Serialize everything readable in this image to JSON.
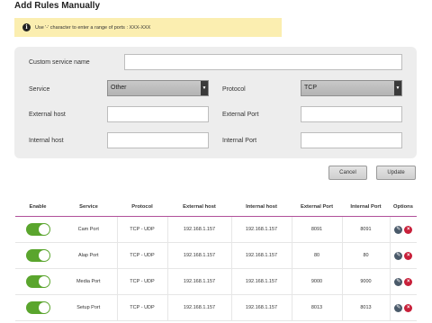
{
  "page": {
    "title": "Add Rules Manually"
  },
  "notice": {
    "text": "Use '-' character to enter a range of ports : XXX-XXX"
  },
  "form": {
    "custom_service_name_label": "Custom service name",
    "custom_service_name_value": "",
    "service_label": "Service",
    "service_value": "Other",
    "protocol_label": "Protocol",
    "protocol_value": "TCP",
    "external_host_label": "External host",
    "external_host_value": "",
    "external_port_label": "External Port",
    "external_port_value": "",
    "internal_host_label": "Internal host",
    "internal_host_value": "",
    "internal_port_label": "Internal Port",
    "internal_port_value": ""
  },
  "actions": {
    "cancel": "Cancel",
    "update": "Update"
  },
  "table": {
    "headers": [
      "Enable",
      "Service",
      "Protocol",
      "External host",
      "Internal host",
      "External Port",
      "Internal Port",
      "Options"
    ],
    "rows": [
      {
        "enabled": true,
        "service": "Cam Port",
        "protocol": "TCP - UDP",
        "external_host": "192.168.1.157",
        "internal_host": "192.168.1.157",
        "external_port": "8091",
        "internal_port": "8091"
      },
      {
        "enabled": true,
        "service": "Alap Port",
        "protocol": "TCP - UDP",
        "external_host": "192.168.1.157",
        "internal_host": "192.168.1.157",
        "external_port": "80",
        "internal_port": "80"
      },
      {
        "enabled": true,
        "service": "Media Port",
        "protocol": "TCP - UDP",
        "external_host": "192.168.1.157",
        "internal_host": "192.168.1.157",
        "external_port": "9000",
        "internal_port": "9000"
      },
      {
        "enabled": true,
        "service": "Setup Port",
        "protocol": "TCP - UDP",
        "external_host": "192.168.1.157",
        "internal_host": "192.168.1.157",
        "external_port": "8013",
        "internal_port": "8013"
      }
    ]
  },
  "icons": {
    "info": "info-icon",
    "dropdown": "chevron-down-icon",
    "edit": "pencil-icon",
    "delete": "close-icon"
  },
  "colors": {
    "toggle_on": "#5aa52d",
    "header_underline": "#b0509a",
    "delete": "#c8203a",
    "notice_bg": "#fbeeb0"
  }
}
